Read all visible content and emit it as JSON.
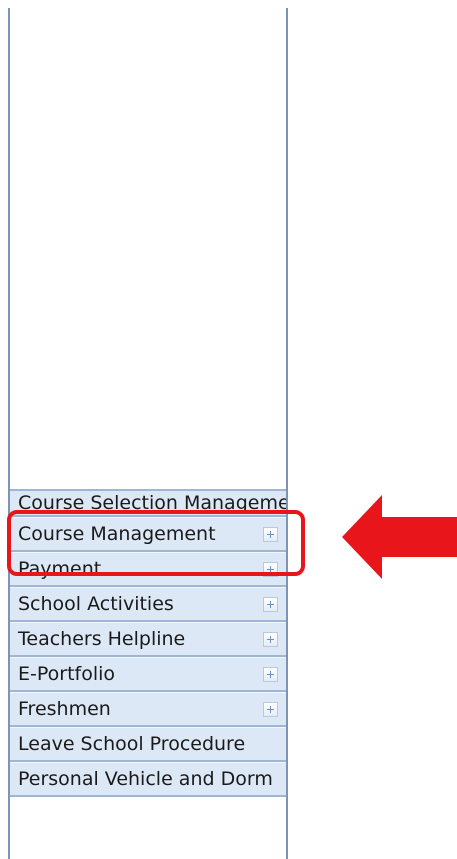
{
  "sidebar": {
    "items": [
      {
        "label": "Course Selection Management",
        "expandable": false
      },
      {
        "label": "Course Management",
        "expandable": true
      },
      {
        "label": "Payment",
        "expandable": true
      },
      {
        "label": "School Activities",
        "expandable": true
      },
      {
        "label": "Teachers Helpline",
        "expandable": true
      },
      {
        "label": "E-Portfolio",
        "expandable": true
      },
      {
        "label": "Freshmen",
        "expandable": true
      },
      {
        "label": "Leave School Procedure",
        "expandable": false
      },
      {
        "label": "Personal Vehicle and Dorm",
        "expandable": false
      }
    ]
  },
  "annotation": {
    "highlight_color": "#e8151b",
    "arrow_icon": "arrow-left-icon"
  },
  "colors": {
    "nav_background": "#dde8f7",
    "nav_border": "#9fb5d4",
    "sidebar_border": "#7f93b3"
  }
}
